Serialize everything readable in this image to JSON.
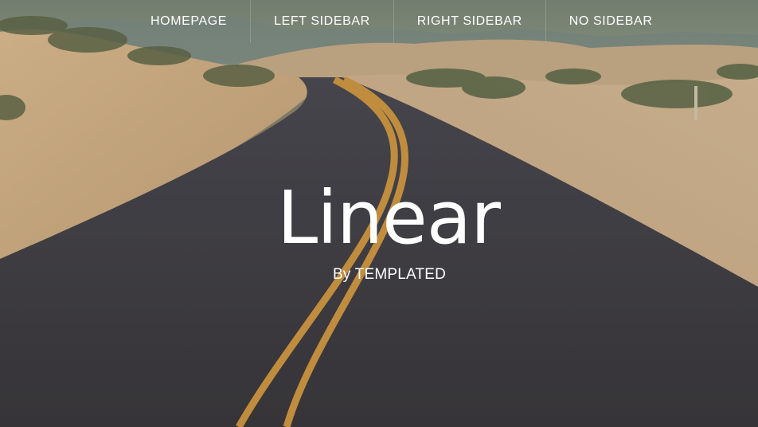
{
  "nav": {
    "items": [
      {
        "label": "HOMEPAGE"
      },
      {
        "label": "LEFT SIDEBAR"
      },
      {
        "label": "RIGHT SIDEBAR"
      },
      {
        "label": "NO SIDEBAR"
      }
    ]
  },
  "hero": {
    "title": "Linear",
    "byline": "By TEMPLATED"
  },
  "colors": {
    "sky": "#7f8a7c",
    "sand": "#d7b58a",
    "road": "#3c3b3f",
    "stripe": "#d9a24a",
    "text": "#ffffff"
  }
}
